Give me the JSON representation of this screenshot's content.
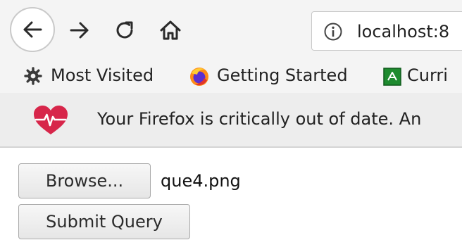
{
  "toolbar": {
    "url": "localhost:8"
  },
  "bookmarks": {
    "items": [
      {
        "label": "Most Visited",
        "icon": "gear-icon"
      },
      {
        "label": "Getting Started",
        "icon": "firefox-icon"
      },
      {
        "label": "Curri",
        "icon": "green-bookmark-icon"
      }
    ]
  },
  "notification": {
    "message": "Your Firefox is critically out of date. An",
    "icon": "heart-icon",
    "icon_color": "#d7264a"
  },
  "form": {
    "browse_label": "Browse...",
    "file_name": "que4.png",
    "submit_label": "Submit Query"
  }
}
